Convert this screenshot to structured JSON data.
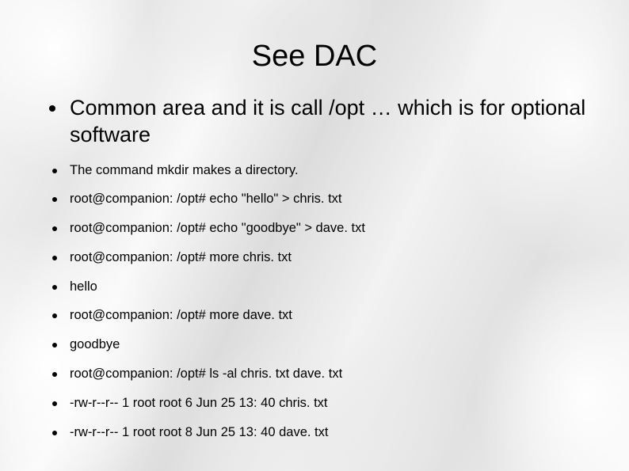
{
  "title": "See DAC",
  "lead": "Common area and it is call /opt  … which is for optional software",
  "items": [
    "The command mkdir makes a directory.",
    "root@companion: /opt# echo \"hello\" > chris. txt",
    "root@companion: /opt# echo \"goodbye\" > dave. txt",
    "root@companion: /opt# more chris. txt",
    "hello",
    "root@companion: /opt# more dave. txt",
    "goodbye",
    "root@companion: /opt# ls -al chris. txt dave. txt",
    "-rw-r--r-- 1 root root 6 Jun 25 13: 40 chris. txt",
    "-rw-r--r-- 1 root root 8 Jun 25 13: 40 dave. txt"
  ]
}
